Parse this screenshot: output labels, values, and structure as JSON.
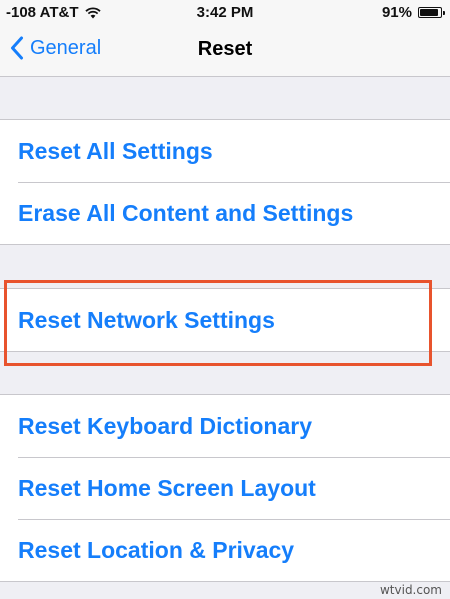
{
  "status_bar": {
    "carrier": "-108 AT&T",
    "time": "3:42 PM",
    "battery_percent_label": "91%",
    "battery_level": 0.91,
    "wifi_icon": "wifi-icon",
    "battery_icon": "battery-icon"
  },
  "nav": {
    "back_label": "General",
    "back_icon": "chevron-left-icon",
    "title": "Reset"
  },
  "groups": [
    {
      "items": [
        {
          "label": "Reset All Settings"
        },
        {
          "label": "Erase All Content and Settings"
        }
      ]
    },
    {
      "items": [
        {
          "label": "Reset Network Settings"
        }
      ]
    },
    {
      "items": [
        {
          "label": "Reset Keyboard Dictionary"
        },
        {
          "label": "Reset Home Screen Layout"
        },
        {
          "label": "Reset Location & Privacy"
        }
      ]
    }
  ],
  "colors": {
    "accent": "#157efb",
    "highlight": "#e8532d",
    "background": "#efeff4"
  },
  "watermark": "wtvid.com"
}
